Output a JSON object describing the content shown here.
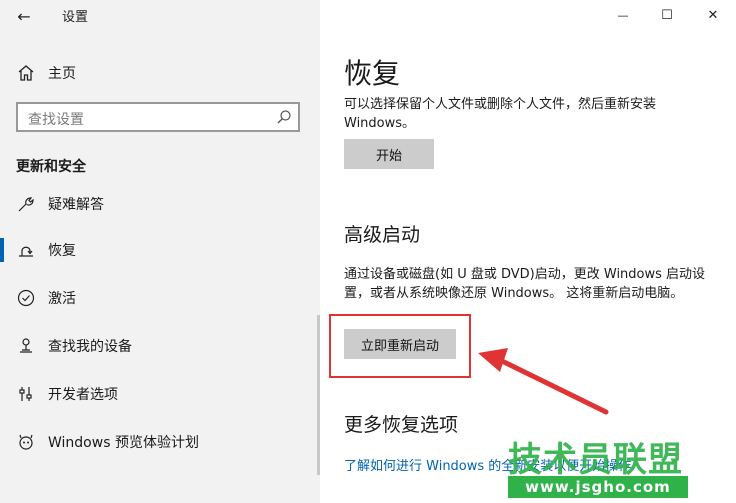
{
  "window": {
    "app_title": "设置",
    "back_glyph": "←",
    "minimize_glyph": "—",
    "maximize_glyph": "☐",
    "close_glyph": "✕"
  },
  "sidebar": {
    "home_label": "主页",
    "search_placeholder": "查找设置",
    "section_title": "更新和安全",
    "items": [
      {
        "label": "疑难解答",
        "icon": "wrench-icon"
      },
      {
        "label": "恢复",
        "icon": "recovery-icon",
        "active": true
      },
      {
        "label": "激活",
        "icon": "activation-icon"
      },
      {
        "label": "查找我的设备",
        "icon": "find-device-icon"
      },
      {
        "label": "开发者选项",
        "icon": "developer-icon"
      },
      {
        "label": "Windows 预览体验计划",
        "icon": "insider-icon"
      }
    ]
  },
  "main": {
    "page_title": "恢复",
    "reset_desc": "可以选择保留个人文件或删除个人文件，然后重新安装 Windows。",
    "reset_button": "开始",
    "advanced_title": "高级启动",
    "advanced_desc": "通过设备或磁盘(如 U 盘或 DVD)启动，更改 Windows 启动设置，或者从系统映像还原 Windows。 这将重新启动电脑。",
    "restart_button": "立即重新启动",
    "more_title": "更多恢复选项",
    "more_link": "了解如何进行 Windows 的全新安装以便开始操作"
  },
  "watermark": {
    "text": "技术员联盟",
    "url": "www.jsgho.com"
  },
  "colors": {
    "accent": "#0063b1",
    "highlight": "#e03434",
    "watermark": "#2fb24a"
  }
}
